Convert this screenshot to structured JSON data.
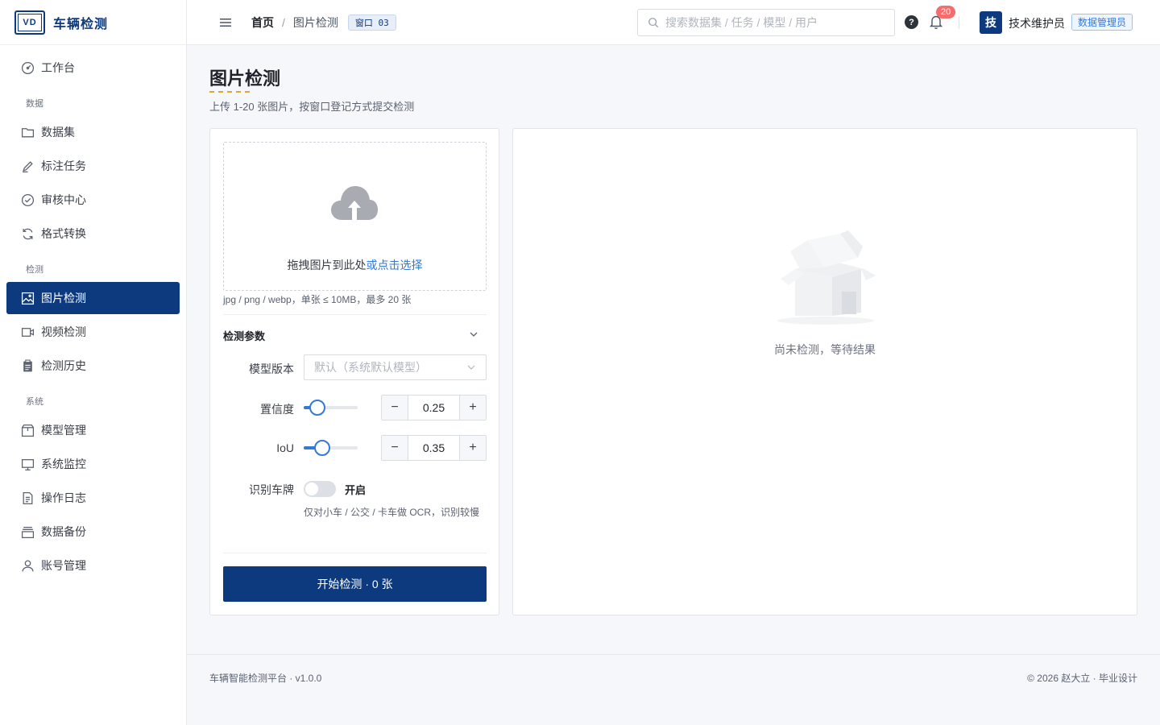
{
  "brand": {
    "logo": "VD",
    "name": "车辆检测"
  },
  "sidebar": {
    "items_top": [
      {
        "label": "工作台",
        "icon": "dashboard-icon"
      }
    ],
    "sections": [
      {
        "title": "数据",
        "items": [
          {
            "label": "数据集",
            "icon": "folder-icon"
          },
          {
            "label": "标注任务",
            "icon": "pen-icon"
          },
          {
            "label": "审核中心",
            "icon": "check-circle-icon"
          },
          {
            "label": "格式转换",
            "icon": "refresh-icon"
          }
        ]
      },
      {
        "title": "检测",
        "items": [
          {
            "label": "图片检测",
            "icon": "image-icon",
            "active": true
          },
          {
            "label": "视频检测",
            "icon": "video-icon"
          },
          {
            "label": "检测历史",
            "icon": "clipboard-icon"
          }
        ]
      },
      {
        "title": "系统",
        "items": [
          {
            "label": "模型管理",
            "icon": "box-icon"
          },
          {
            "label": "系统监控",
            "icon": "monitor-icon"
          },
          {
            "label": "操作日志",
            "icon": "document-icon"
          },
          {
            "label": "数据备份",
            "icon": "archive-icon"
          },
          {
            "label": "账号管理",
            "icon": "user-icon"
          }
        ]
      }
    ]
  },
  "header": {
    "breadcrumb": {
      "home": "首页",
      "sep": "/",
      "current": "图片检测"
    },
    "window_tag": "窗口 03",
    "search_placeholder": "搜索数据集 / 任务 / 模型 / 用户",
    "help": "?",
    "notification_count": "20",
    "avatar": "技",
    "username": "技术维护员",
    "role": "数据管理员"
  },
  "page": {
    "title": "图片检测",
    "subtitle": "上传 1-20 张图片，按窗口登记方式提交检测"
  },
  "upload": {
    "drop_text": "拖拽图片到此处",
    "drop_link": "或点击选择",
    "hint": "jpg / png / webp，单张 ≤ 10MB，最多 20 张"
  },
  "params": {
    "title": "检测参数",
    "model_label": "模型版本",
    "model_placeholder": "默认（系统默认模型）",
    "confidence_label": "置信度",
    "confidence_value": "0.25",
    "confidence_fraction": 0.25,
    "iou_label": "IoU",
    "iou_value": "0.35",
    "iou_fraction": 0.35,
    "plate_label": "识别车牌",
    "plate_toggle_text": "开启",
    "plate_on": false,
    "plate_hint": "仅对小车 / 公交 / 卡车做 OCR，识别较慢"
  },
  "start_button": "开始检测 · 0 张",
  "result": {
    "empty_text": "尚未检测，等待结果"
  },
  "footer": {
    "left": "车辆智能检测平台 · v1.0.0",
    "right": "© 2026 赵大立 · 毕业设计"
  },
  "colors": {
    "primary": "#0d3a7e",
    "accent": "#3478d8",
    "badge": "#f56c6c"
  }
}
